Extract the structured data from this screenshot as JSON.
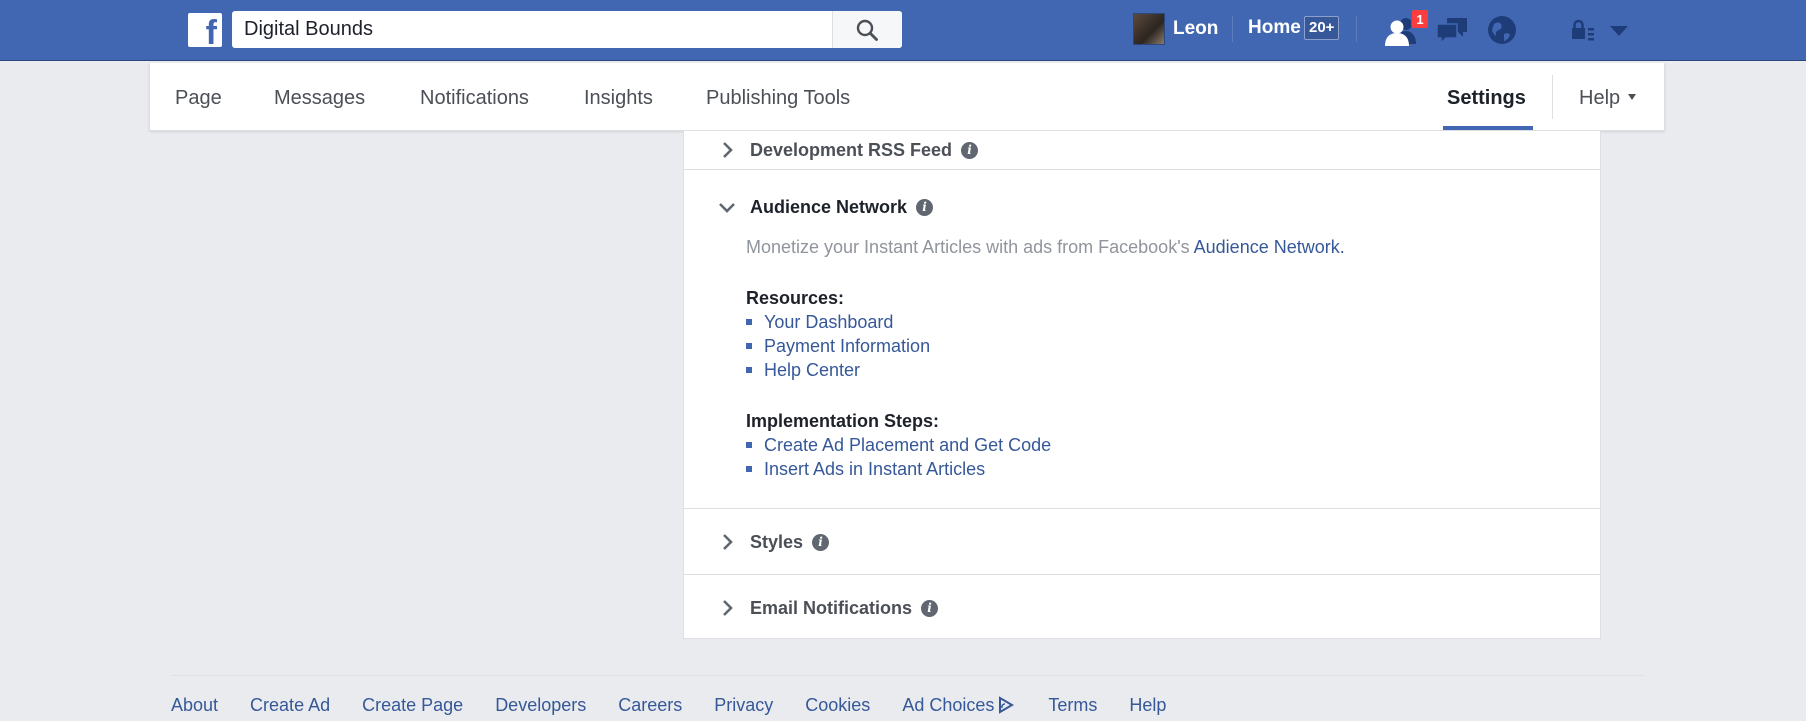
{
  "topbar": {
    "logo_letter": "f",
    "search": {
      "value": "Digital Bounds",
      "placeholder": "Search"
    },
    "user_name": "Leon",
    "home_label": "Home",
    "home_badge": "20+",
    "friend_requests_count": "1",
    "accent": "#4267b2"
  },
  "page_nav": {
    "tabs": [
      {
        "label": "Page"
      },
      {
        "label": "Messages"
      },
      {
        "label": "Notifications"
      },
      {
        "label": "Insights"
      },
      {
        "label": "Publishing Tools"
      }
    ],
    "settings_label": "Settings",
    "help_label": "Help"
  },
  "settings": {
    "dev_rss": {
      "title": "Development RSS Feed"
    },
    "audience_network": {
      "title": "Audience Network",
      "description": "Monetize your Instant Articles with ads from Facebook's",
      "description_link": "Audience Network.",
      "resources_heading": "Resources:",
      "resources": [
        "Your Dashboard",
        "Payment Information",
        "Help Center"
      ],
      "steps_heading": "Implementation Steps:",
      "steps": [
        "Create Ad Placement and Get Code",
        "Insert Ads in Instant Articles"
      ]
    },
    "styles": {
      "title": "Styles"
    },
    "email_notifications": {
      "title": "Email Notifications"
    },
    "info_glyph": "i"
  },
  "footer": {
    "links": [
      "About",
      "Create Ad",
      "Create Page",
      "Developers",
      "Careers",
      "Privacy",
      "Cookies",
      "Ad Choices",
      "Terms",
      "Help"
    ]
  }
}
